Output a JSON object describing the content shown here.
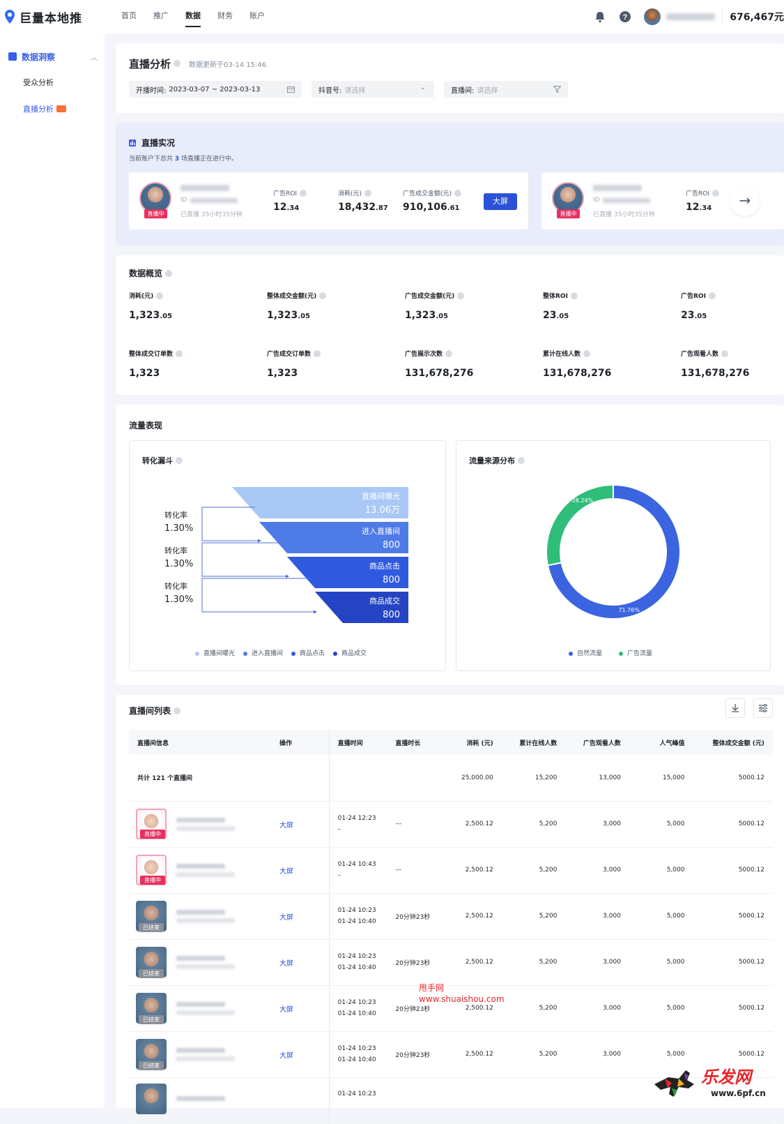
{
  "app": {
    "name": "巨量本地推",
    "balance": "676,467元"
  },
  "nav": {
    "items": [
      "首页",
      "推广",
      "数据",
      "财务",
      "账户"
    ],
    "active": 2
  },
  "sidebar": {
    "section": "数据洞察",
    "items": [
      "受众分析",
      "直播分析"
    ],
    "active": 1,
    "new_badge": "新"
  },
  "header": {
    "title": "直播分析",
    "updated": "数据更新于03-14 15:46",
    "filters": {
      "time_label": "开播时间:",
      "time_value": "2023-03-07 ~ 2023-03-13",
      "douyin_label": "抖音号:",
      "douyin_placeholder": "请选择",
      "room_label": "直播间:",
      "room_placeholder": "请选择"
    }
  },
  "live_now": {
    "title": "直播实况",
    "note_prefix": "当前账户下总共",
    "note_count": "3",
    "note_suffix": "场直播正在进行中。",
    "card": {
      "tag": "直播中",
      "id_label": "ID",
      "duration": "已直播 35小时35分钟",
      "ad_roi_label": "广告ROI",
      "ad_roi_int": "12",
      "ad_roi_dec": ".34",
      "cost_label": "消耗(元)",
      "cost_int": "18,432",
      "cost_dec": ".87",
      "gmv_label": "广告成交金额(元)",
      "gmv_int": "910,106",
      "gmv_dec": ".61",
      "big_screen": "大屏"
    }
  },
  "overview": {
    "title": "数据概览",
    "metrics": [
      {
        "label": "消耗(元)",
        "int": "1,323",
        "dec": ".05"
      },
      {
        "label": "整体成交金额(元)",
        "int": "1,323",
        "dec": ".05"
      },
      {
        "label": "广告成交金额(元)",
        "int": "1,323",
        "dec": ".05"
      },
      {
        "label": "整体ROI",
        "int": "23",
        "dec": ".05"
      },
      {
        "label": "广告ROI",
        "int": "23",
        "dec": ".05"
      },
      {
        "label": "整体成交订单数",
        "int": "1,323",
        "dec": ""
      },
      {
        "label": "广告成交订单数",
        "int": "1,323",
        "dec": ""
      },
      {
        "label": "广告展示次数",
        "int": "131,678,276",
        "dec": ""
      },
      {
        "label": "累计在线人数",
        "int": "131,678,276",
        "dec": ""
      },
      {
        "label": "广告观看人数",
        "int": "131,678,276",
        "dec": ""
      }
    ]
  },
  "traffic": {
    "title": "流量表现",
    "funnel": {
      "title": "转化漏斗",
      "stages": [
        {
          "name": "直播间曝光",
          "value": "13.06",
          "unit": "万",
          "color": "#a9c8f5",
          "text": "#ffffff"
        },
        {
          "name": "进入直播间",
          "value": "800",
          "unit": "",
          "color": "#4f7be6",
          "text": "#ffffff"
        },
        {
          "name": "商品点击",
          "value": "800",
          "unit": "",
          "color": "#2f5ae0",
          "text": "#ffffff"
        },
        {
          "name": "商品成交",
          "value": "800",
          "unit": "",
          "color": "#2544c4",
          "text": "#ffffff"
        }
      ],
      "rates": [
        {
          "label": "转化率",
          "value": "1.30%"
        },
        {
          "label": "转化率",
          "value": "1.30%"
        },
        {
          "label": "转化率",
          "value": "1.30%"
        }
      ]
    },
    "source": {
      "title": "流量来源分布",
      "series": [
        {
          "name": "自然流量",
          "value": 71.76,
          "label": "71.76%",
          "color": "#3b64e0"
        },
        {
          "name": "广告流量",
          "value": 28.24,
          "label": "28.24%",
          "color": "#2fbd7a"
        }
      ]
    }
  },
  "chart_data": {
    "type": "pie",
    "categories": [
      "自然流量",
      "广告流量"
    ],
    "values": [
      71.76,
      28.24
    ],
    "title": "流量来源分布"
  },
  "list": {
    "title": "直播间列表",
    "headers": [
      "直播间信息",
      "操作",
      "直播时间",
      "直播时长",
      "消耗 (元)",
      "累计在线人数",
      "广告观看人数",
      "人气峰值",
      "整体成交金额 (元)"
    ],
    "summary": {
      "label": "共计 121 个直播间",
      "cost": "25,000.00",
      "online": "15,200",
      "viewers": "13,000",
      "peak": "15,000",
      "gmv": "5000.12"
    },
    "rows": [
      {
        "status": "直播中",
        "live": true,
        "action": "大屏",
        "start": "01-24 12:23",
        "end": "–",
        "duration": "––",
        "cost": "2,500.12",
        "online": "5,200",
        "viewers": "3,000",
        "peak": "5,000",
        "gmv": "5000.12"
      },
      {
        "status": "直播中",
        "live": true,
        "action": "大屏",
        "start": "01-24 10:43",
        "end": "–",
        "duration": "––",
        "cost": "2,500.12",
        "online": "5,200",
        "viewers": "3,000",
        "peak": "5,000",
        "gmv": "5000.12"
      },
      {
        "status": "已结束",
        "live": false,
        "action": "大屏",
        "start": "01-24 10:23",
        "end": "01-24 10:40",
        "duration": "20分钟23秒",
        "cost": "2,500.12",
        "online": "5,200",
        "viewers": "3,000",
        "peak": "5,000",
        "gmv": "5000.12"
      },
      {
        "status": "已结束",
        "live": false,
        "action": "大屏",
        "start": "01-24 10:23",
        "end": "01-24 10:40",
        "duration": "20分钟23秒",
        "cost": "2,500.12",
        "online": "5,200",
        "viewers": "3,000",
        "peak": "5,000",
        "gmv": "5000.12"
      },
      {
        "status": "已结束",
        "live": false,
        "action": "大屏",
        "start": "01-24 10:23",
        "end": "01-24 10:40",
        "duration": "20分钟23秒",
        "cost": "2,500.12",
        "online": "5,200",
        "viewers": "3,000",
        "peak": "5,000",
        "gmv": "5000.12"
      },
      {
        "status": "已结束",
        "live": false,
        "action": "大屏",
        "start": "01-24 10:23",
        "end": "01-24 10:40",
        "duration": "20分钟23秒",
        "cost": "2,500.12",
        "online": "5,200",
        "viewers": "3,000",
        "peak": "5,000",
        "gmv": "5000.12"
      }
    ],
    "partial_row_start": "01-24 10:23"
  },
  "watermark": {
    "line1": "甩手网",
    "line2": "www.shuaishou.com",
    "corner_text": "乐发网",
    "corner_url": "www.6pf.cn"
  }
}
